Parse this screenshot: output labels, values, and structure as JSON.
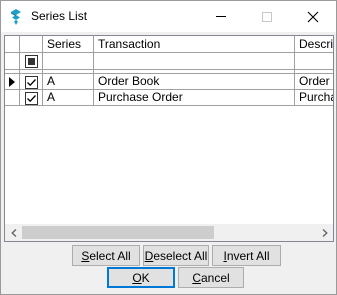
{
  "window": {
    "title": "Series List",
    "icon": "app-logo-icon",
    "controls": [
      "minimize-icon",
      "maximize-icon",
      "close-icon"
    ]
  },
  "grid": {
    "columns": [
      "Series",
      "Transaction",
      "Descrip"
    ],
    "rows": [
      {
        "checked": true,
        "current": true,
        "series": "A",
        "transaction": "Order Book",
        "description": "Order B"
      },
      {
        "checked": true,
        "current": false,
        "series": "A",
        "transaction": "Purchase Order",
        "description": "Purcha"
      }
    ]
  },
  "buttons": {
    "select_all": {
      "accel": "S",
      "rest": "elect All"
    },
    "deselect_all": {
      "accel": "D",
      "rest": "eselect All"
    },
    "invert_all": {
      "accel": "I",
      "rest": "nvert All"
    },
    "ok": {
      "accel": "O",
      "rest": "K"
    },
    "cancel": {
      "accel": "C",
      "rest": "ancel"
    }
  },
  "colors": {
    "accent": "#0078d7",
    "logo": "#1ba1c7"
  }
}
